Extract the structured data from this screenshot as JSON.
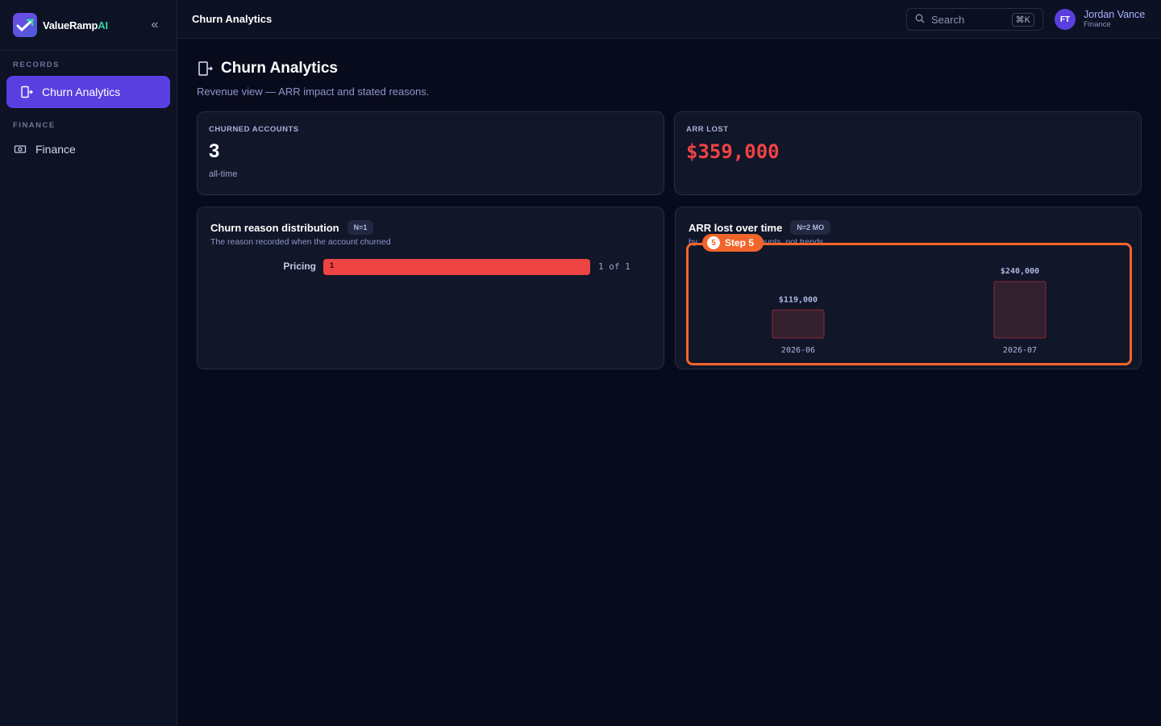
{
  "brand": {
    "name_main": "ValueRamp",
    "name_ai": "AI",
    "collapse_icon": "chevrons-left-icon"
  },
  "sidebar": {
    "sections": [
      {
        "label": "RECORDS",
        "items": [
          {
            "label": "Churn Analytics",
            "icon": "door-exit-icon",
            "active": true
          }
        ]
      },
      {
        "label": "FINANCE",
        "items": [
          {
            "label": "Finance",
            "icon": "cash-icon",
            "active": false
          }
        ]
      }
    ]
  },
  "topbar": {
    "title": "Churn Analytics",
    "search": {
      "label": "Search",
      "shortcut": "⌘K"
    },
    "user": {
      "initials": "FT",
      "name": "Jordan Vance",
      "role": "Finance"
    }
  },
  "page": {
    "title": "Churn Analytics",
    "subtitle": "Revenue view — ARR impact and stated reasons."
  },
  "kpis": {
    "churned": {
      "label": "CHURNED ACCOUNTS",
      "value": "3",
      "note": "all-time"
    },
    "arr_lost": {
      "label": "ARR LOST",
      "value": "$359,000"
    }
  },
  "reasons": {
    "title": "Churn reason distribution",
    "pill": "N=1",
    "subtitle": "The reason recorded when the account churned",
    "rows": [
      {
        "label": "Pricing",
        "count": "1",
        "summary": "1 of 1",
        "fraction": 1.0
      }
    ]
  },
  "arr_over_time": {
    "title": "ARR lost over time",
    "pill": "N=2 MO",
    "subtitle_left": "by",
    "subtitle_right": "ounts, not trends"
  },
  "step": {
    "number": "5",
    "label": "Step 5"
  },
  "colors": {
    "accent": "#5a3fe0",
    "danger": "#ef4444",
    "highlight": "#f2652a",
    "teal": "#32d5a0"
  },
  "chart_data": {
    "type": "bar",
    "title": "ARR lost over time",
    "categories": [
      "2026-06",
      "2026-07"
    ],
    "values": [
      119000,
      240000
    ],
    "value_labels": [
      "$119,000",
      "$240,000"
    ],
    "xlabel": "",
    "ylabel": "",
    "ylim": [
      0,
      240000
    ]
  }
}
